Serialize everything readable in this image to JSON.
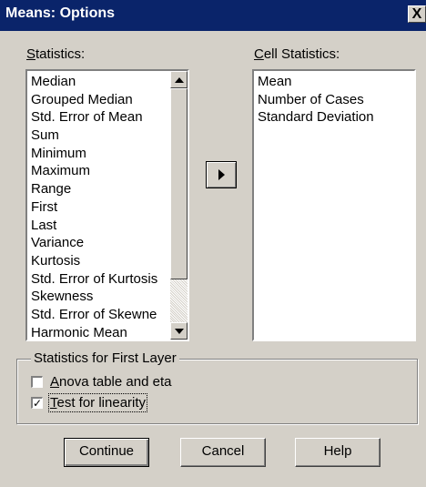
{
  "window": {
    "title": "Means: Options",
    "close_glyph": "X"
  },
  "statistics": {
    "label": "Statistics:",
    "underline_char": "S",
    "label_rest": "tatistics:",
    "items": [
      "Median",
      "Grouped Median",
      "Std. Error of Mean",
      "Sum",
      "Minimum",
      "Maximum",
      "Range",
      "First",
      "Last",
      "Variance",
      "Kurtosis",
      "Std. Error of Kurtosis",
      "Skewness",
      "Std. Error of Skewne",
      "Harmonic Mean"
    ]
  },
  "cell_statistics": {
    "label": "Cell Statistics:",
    "underline_char": "C",
    "label_rest": "ell Statistics:",
    "items": [
      "Mean",
      "Number of Cases",
      "Standard Deviation"
    ]
  },
  "first_layer": {
    "title": "Statistics for First Layer",
    "anova": {
      "underline_char": "A",
      "label_rest": "nova table and eta",
      "checked": false
    },
    "linearity": {
      "underline_char": "T",
      "label_rest": "est for linearity",
      "checked": true,
      "check_glyph": "✓"
    }
  },
  "buttons": {
    "continue": "Continue",
    "cancel": "Cancel",
    "help": "Help"
  },
  "icons": {
    "move": "right-arrow-icon",
    "scroll_up": "up-arrow-icon",
    "scroll_down": "down-arrow-icon"
  }
}
